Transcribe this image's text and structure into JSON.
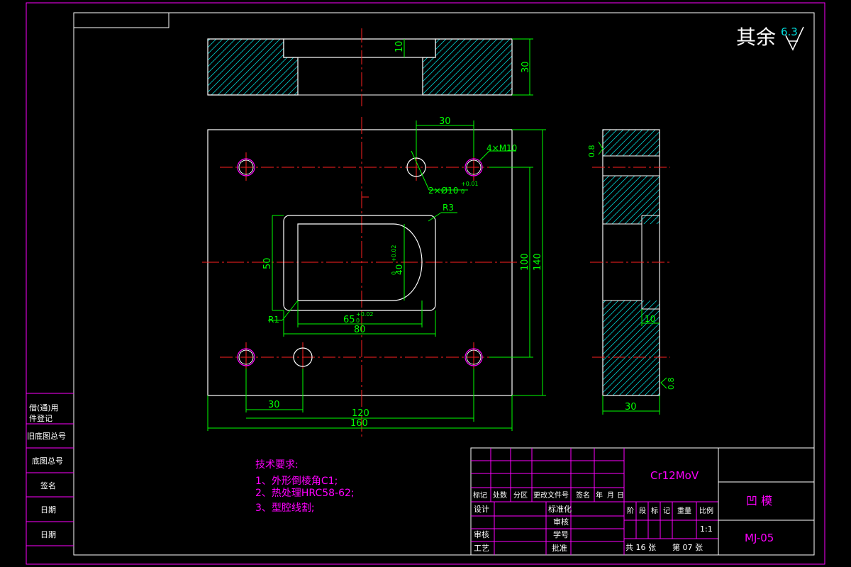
{
  "drawing": {
    "roughness_prefix": "其余",
    "roughness_value": "6.3"
  },
  "dims": {
    "top_depth": "10",
    "top_height": "30",
    "hole_spacing": "30",
    "thread": "4×M10",
    "pin_holes": "2×Ø10",
    "pin_tol_upper": "+0.01",
    "pin_tol_lower": "0",
    "corner_r3": "R3",
    "corner_r1": "R1",
    "cavity_height": "50",
    "slot_width": "40",
    "slot_tol_upper": "+0.02",
    "slot_tol_lower": "0",
    "slot_length": "65",
    "len_tol_upper": "+0.02",
    "len_tol_lower": "0",
    "cavity_width": "80",
    "inner_height": "100",
    "plate_height": "140",
    "bottom_spacing": "30",
    "hole_center_width": "120",
    "plate_width": "160",
    "side_roughness_top": "0.8",
    "side_depth": "10",
    "side_roughness_bottom": "0.8",
    "side_width": "30"
  },
  "side_labels": [
    "借(通)用",
    "件登记",
    "旧底图总号",
    "底图总号",
    "签名",
    "日期",
    "日期"
  ],
  "tech": {
    "title": "技术要求:",
    "items": [
      "1、外形倒棱角C1;",
      "2、热处理HRC58-62;",
      "3、型腔线割;"
    ]
  },
  "title_block": {
    "material": "Cr12MoV",
    "part_name": "凹  模",
    "drawing_no": "MJ-05",
    "rev_headers": [
      "标记",
      "处数",
      "分区",
      "更改文件号",
      "签名",
      "年",
      "月",
      "日"
    ],
    "design": "设计",
    "standardize": "标准化",
    "review": "审核",
    "process": "工艺",
    "inspect": "审核",
    "approve_label": "学号",
    "approve": "批准",
    "stage_headers": [
      "阶",
      "段",
      "标",
      "记",
      "重量",
      "比例"
    ],
    "scale": "1:1",
    "sheets_total": "共 16 张",
    "sheet_no": "第 07 张"
  }
}
